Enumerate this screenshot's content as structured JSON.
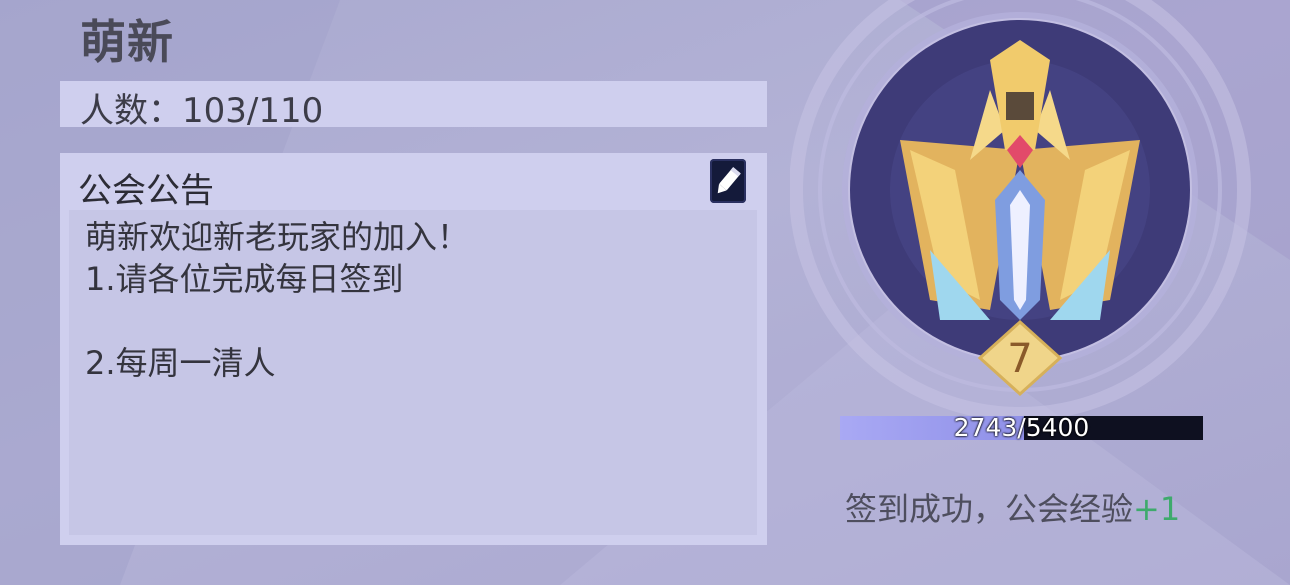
{
  "guild": {
    "name": "萌新"
  },
  "members": {
    "text": "人数：103/110"
  },
  "notice": {
    "title": "公会公告",
    "lines": [
      "萌新欢迎新老玩家的加入！",
      "1.请各位完成每日签到",
      "",
      "2.每周一清人"
    ]
  },
  "emblem": {
    "level": "7"
  },
  "experience": {
    "text": "2743/5400",
    "current": 2743,
    "max": 5400
  },
  "checkin": {
    "message": "签到成功，公会经验",
    "bonus": "+1"
  },
  "colors": {
    "panel": "#cfcfee",
    "bonus": "#3eaa6c",
    "emblem_gold": "#f0c86a"
  }
}
